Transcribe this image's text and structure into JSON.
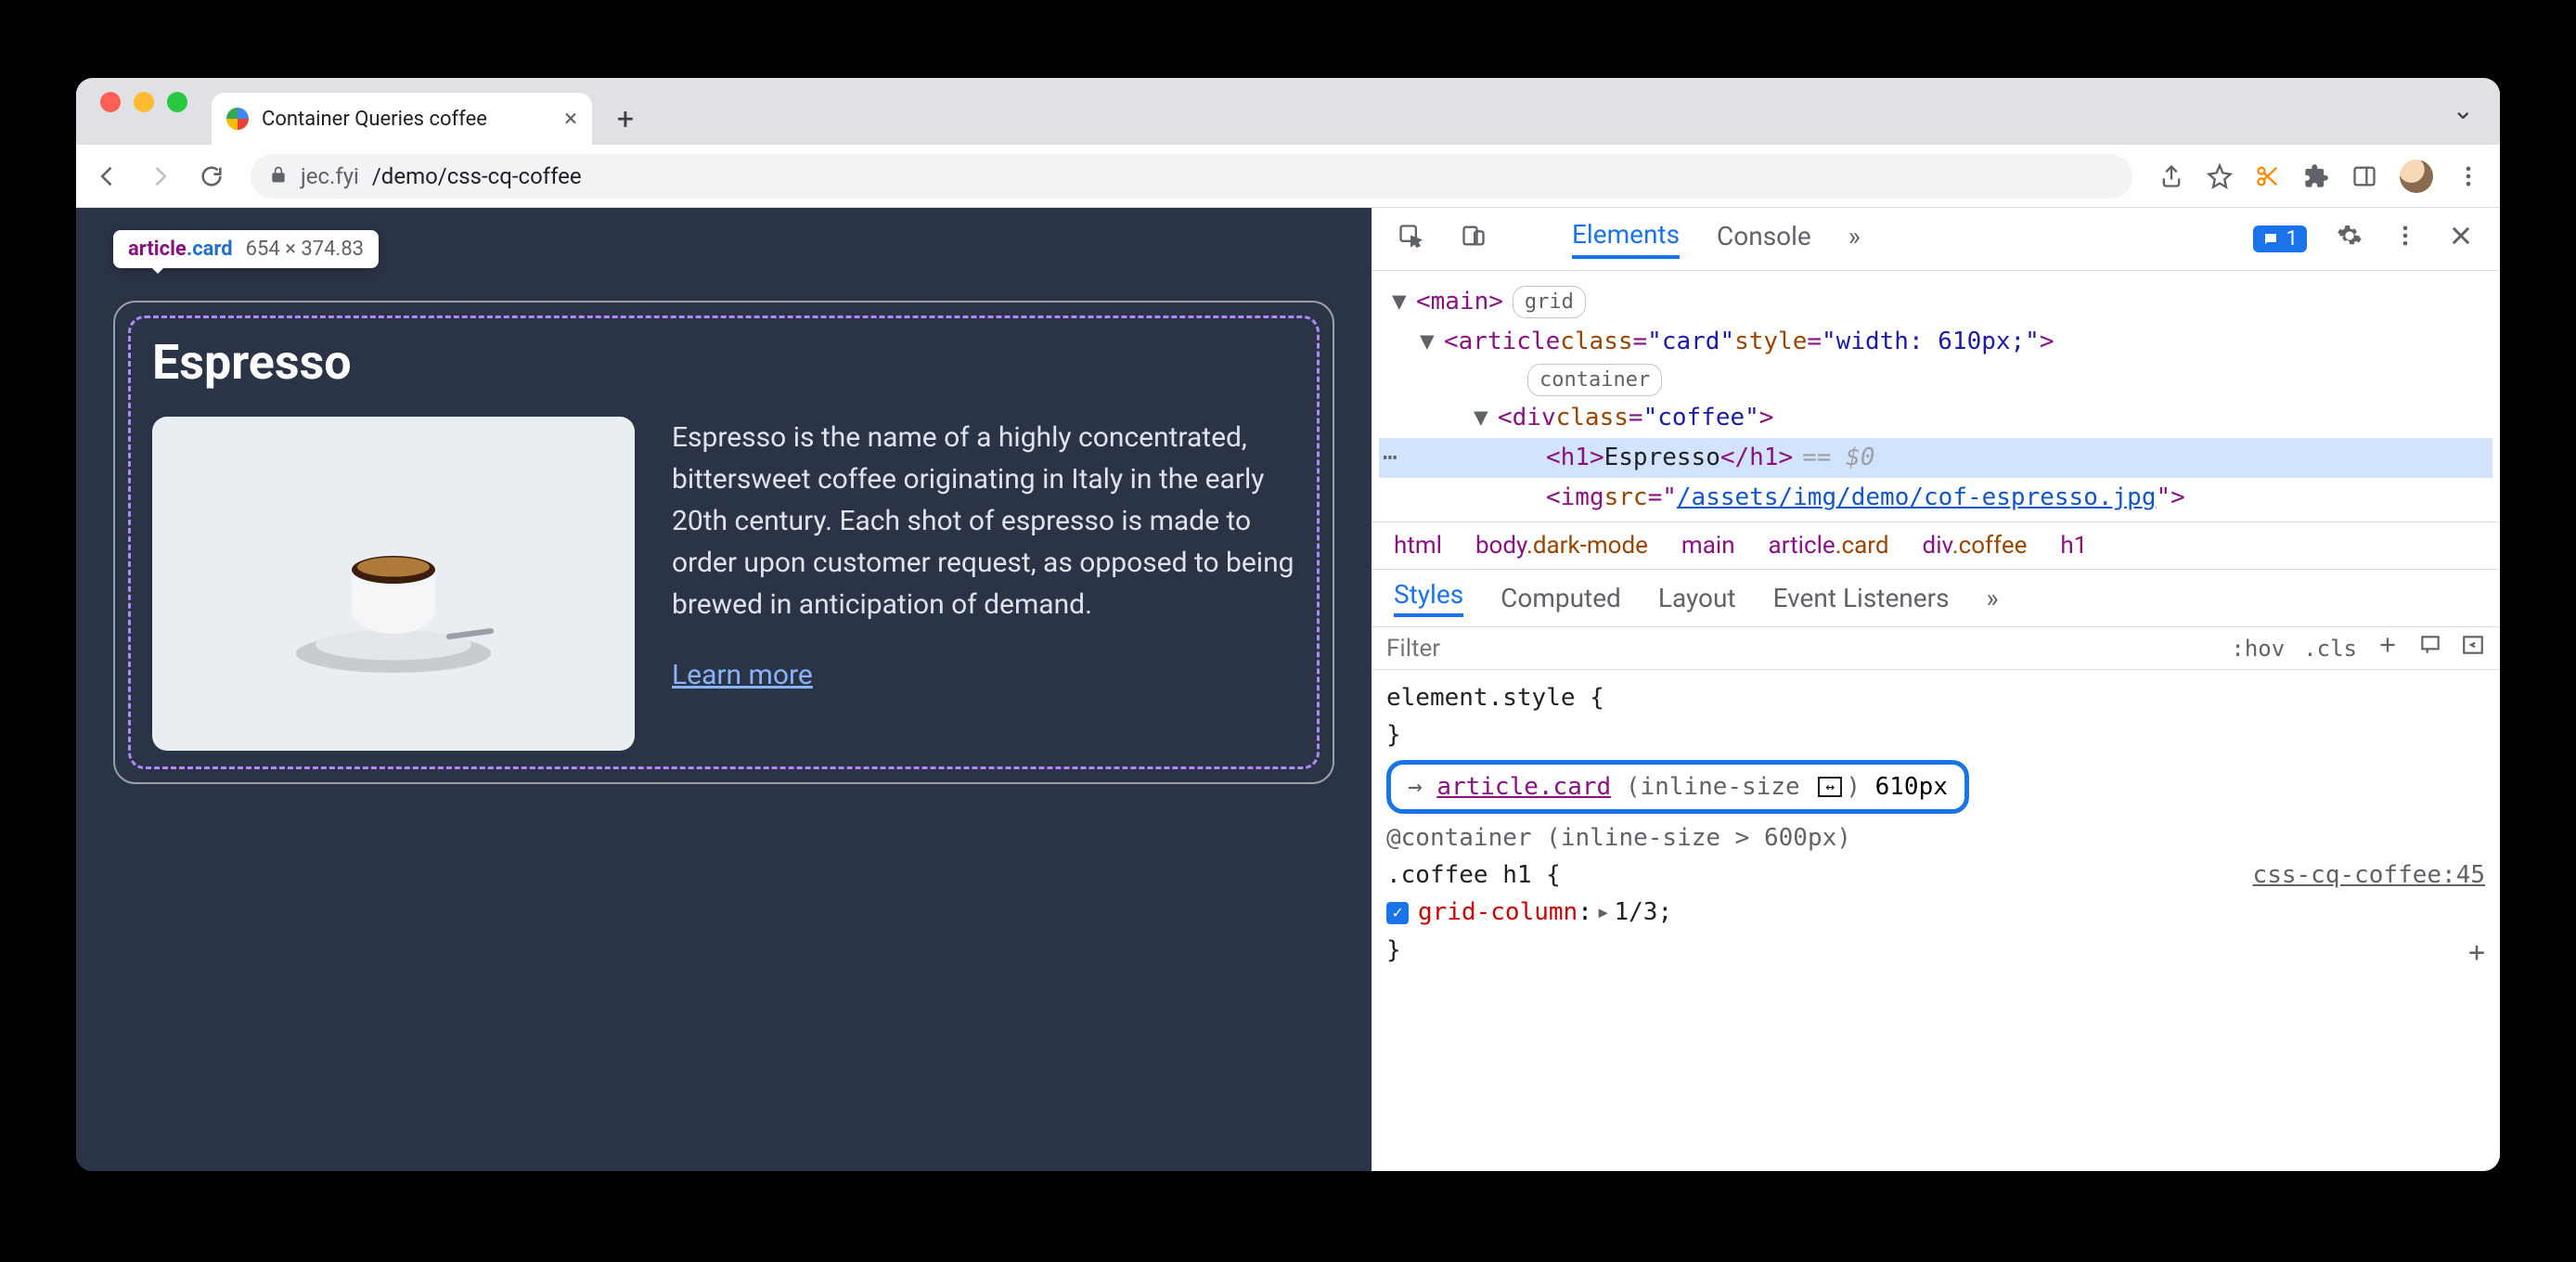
{
  "browser": {
    "tab_title": "Container Queries coffee",
    "url_host": "jec.fyi",
    "url_path": "/demo/css-cq-coffee"
  },
  "inspect_tooltip": {
    "element": "article",
    "class": ".card",
    "dimensions": "654 × 374.83"
  },
  "page": {
    "heading": "Espresso",
    "description": "Espresso is the name of a highly concentrated, bittersweet coffee originating in Italy in the early 20th century. Each shot of espresso is made to order upon customer request, as opposed to being brewed in anticipation of demand.",
    "learn_more": "Learn more"
  },
  "devtools": {
    "tabs": {
      "elements": "Elements",
      "console": "Console",
      "more": "»",
      "issues_count": "1"
    },
    "dom": {
      "main_open": "<main>",
      "main_badge": "grid",
      "article_open_1": "<article ",
      "article_class_attr": "class",
      "article_class_val": "\"card\"",
      "article_style_attr": "style",
      "article_style_val": "\"width: 610px;\"",
      "article_close": ">",
      "article_badge": "container",
      "div_open": "<div ",
      "div_class_attr": "class",
      "div_class_val": "\"coffee\"",
      "div_close": ">",
      "h1_open": "<h1>",
      "h1_text": "Espresso",
      "h1_close": "</h1>",
      "eq0": "== $0",
      "img_open": "<img ",
      "img_src_attr": "src",
      "img_src_val": "/assets/img/demo/cof-espresso.jpg",
      "img_close": "\">"
    },
    "crumbs": {
      "c1_el": "html",
      "c2_el": "body",
      "c2_cls": ".dark-mode",
      "c3_el": "main",
      "c4_el": "article",
      "c4_cls": ".card",
      "c5_el": "div",
      "c5_cls": ".coffee",
      "c6_el": "h1"
    },
    "panes": {
      "styles": "Styles",
      "computed": "Computed",
      "layout": "Layout",
      "listeners": "Event Listeners",
      "more": "»"
    },
    "filter": {
      "placeholder": "Filter",
      "hov": ":hov",
      "cls": ".cls"
    },
    "styles": {
      "element_style": "element.style {",
      "brace_close": "}",
      "hl_sel": "article.card",
      "hl_paren_open": "(",
      "hl_prop": "inline-size",
      "hl_paren_close": ")",
      "hl_val": "610px",
      "at_container": "@container (inline-size > 600px)",
      "rule_sel": ".coffee h1 {",
      "src": "css-cq-coffee:45",
      "prop": "grid-column",
      "pval": "1/3;",
      "arrow_label": "→"
    }
  }
}
